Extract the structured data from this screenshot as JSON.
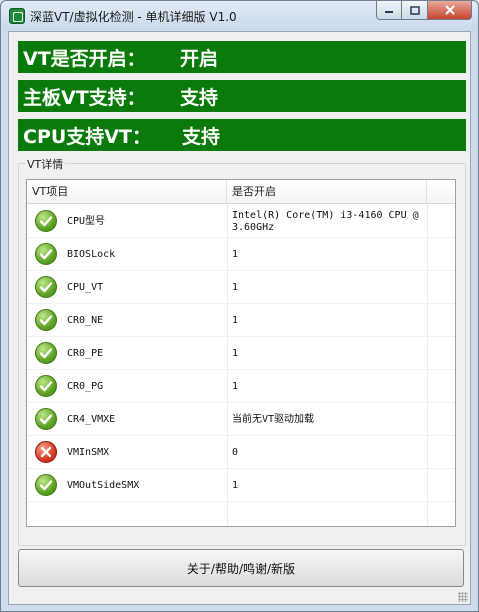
{
  "window": {
    "title": "深蓝VT/虚拟化检测 - 单机详细版 V1.0"
  },
  "status": {
    "vt_enabled": {
      "label": "VT是否开启：",
      "value": "开启"
    },
    "board_support": {
      "label": "主板VT支持：",
      "value": "支持"
    },
    "cpu_support": {
      "label": "CPU支持VT：",
      "value": "支持"
    },
    "bar_color": "#0a7a0a"
  },
  "details": {
    "group_title": "VT详情",
    "columns": [
      "VT项目",
      "是否开启"
    ],
    "rows": [
      {
        "icon": "check-icon",
        "name": "CPU型号",
        "value": "Intel(R) Core(TM) i3-4160 CPU @ 3.60GHz"
      },
      {
        "icon": "check-icon",
        "name": "BIOSLock",
        "value": "1"
      },
      {
        "icon": "check-icon",
        "name": "CPU_VT",
        "value": "1"
      },
      {
        "icon": "check-icon",
        "name": "CR0_NE",
        "value": "1"
      },
      {
        "icon": "check-icon",
        "name": "CR0_PE",
        "value": "1"
      },
      {
        "icon": "check-icon",
        "name": "CR0_PG",
        "value": "1"
      },
      {
        "icon": "check-icon",
        "name": "CR4_VMXE",
        "value": "当前无VT驱动加载"
      },
      {
        "icon": "cross-icon",
        "name": "VMInSMX",
        "value": "0"
      },
      {
        "icon": "check-icon",
        "name": "VMOutSideSMX",
        "value": "1"
      }
    ]
  },
  "footer": {
    "about_label": "关于/帮助/鸣谢/新版"
  },
  "colors": {
    "ok": "#5fa324",
    "error": "#d93a22"
  }
}
